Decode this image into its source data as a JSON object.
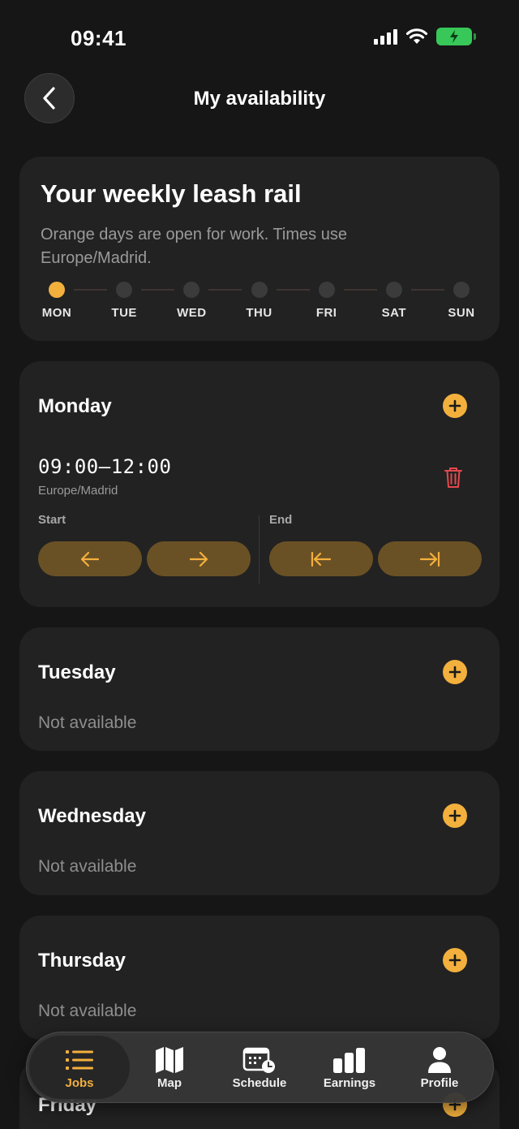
{
  "status_bar": {
    "time": "09:41"
  },
  "header": {
    "title": "My availability"
  },
  "rail_card": {
    "title": "Your weekly leash rail",
    "description": "Orange days are open for work. Times use Europe/Madrid.",
    "days": [
      {
        "label": "MON",
        "open": true
      },
      {
        "label": "TUE",
        "open": false
      },
      {
        "label": "WED",
        "open": false
      },
      {
        "label": "THU",
        "open": false
      },
      {
        "label": "FRI",
        "open": false
      },
      {
        "label": "SAT",
        "open": false
      },
      {
        "label": "SUN",
        "open": false
      }
    ]
  },
  "monday": {
    "title": "Monday",
    "slot": {
      "range": "09:00–12:00",
      "timezone": "Europe/Madrid"
    },
    "start_label": "Start",
    "end_label": "End"
  },
  "tuesday": {
    "title": "Tuesday",
    "status": "Not available"
  },
  "wednesday": {
    "title": "Wednesday",
    "status": "Not available"
  },
  "thursday": {
    "title": "Thursday",
    "status": "Not available"
  },
  "friday": {
    "title": "Friday"
  },
  "tabbar": {
    "tabs": [
      {
        "label": "Jobs",
        "icon": "list-icon",
        "active": true
      },
      {
        "label": "Map",
        "icon": "map-icon",
        "active": false
      },
      {
        "label": "Schedule",
        "icon": "calendar-clock-icon",
        "active": false
      },
      {
        "label": "Earnings",
        "icon": "bar-chart-icon",
        "active": false
      },
      {
        "label": "Profile",
        "icon": "person-icon",
        "active": false
      }
    ]
  },
  "colors": {
    "accent": "#f3b03d",
    "danger": "#e5484d",
    "card": "#222222",
    "background": "#161616"
  }
}
